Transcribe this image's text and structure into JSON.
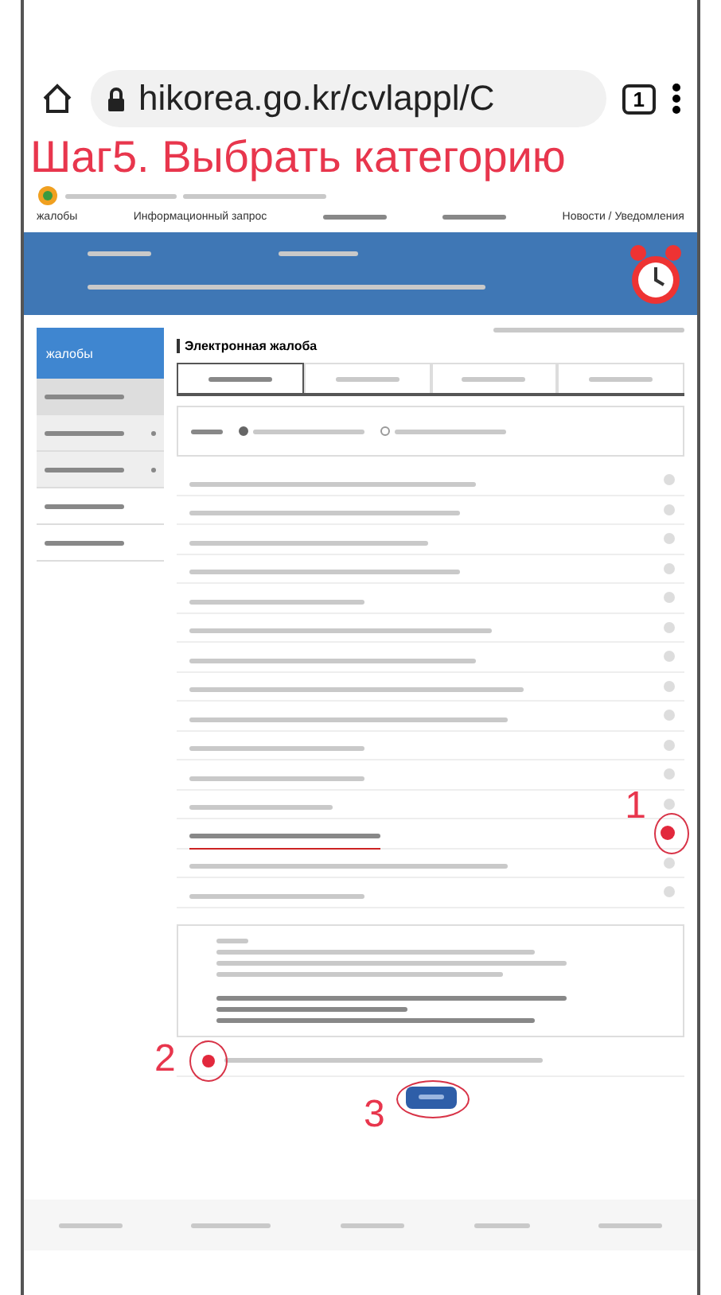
{
  "browser": {
    "url": "hikorea.go.kr/cvlappl/C",
    "tab_count": "1"
  },
  "annotation_title": "Шаг5. Выбрать категорию",
  "nav": [
    {
      "label": "жалобы"
    },
    {
      "label": "Информационный запрос"
    },
    {
      "label": "Новости / Уведомления"
    }
  ],
  "sidebar": {
    "title": "жалобы",
    "items": [
      {
        "selected": true,
        "expandable": false
      },
      {
        "selected": false,
        "expandable": true
      },
      {
        "selected": false,
        "expandable": true
      },
      {
        "selected": false,
        "expandable": false
      },
      {
        "selected": false,
        "expandable": false
      }
    ]
  },
  "page_title": "Электронная жалоба",
  "tabs": [
    {
      "selected": true
    },
    {
      "selected": false
    },
    {
      "selected": false
    },
    {
      "selected": false
    }
  ],
  "applicant_options": [
    {
      "selected": true
    },
    {
      "selected": false
    }
  ],
  "categories": [
    {
      "selected": false
    },
    {
      "selected": false
    },
    {
      "selected": false
    },
    {
      "selected": false
    },
    {
      "selected": false
    },
    {
      "selected": false
    },
    {
      "selected": false
    },
    {
      "selected": false
    },
    {
      "selected": false
    },
    {
      "selected": false
    },
    {
      "selected": false
    },
    {
      "selected": false
    },
    {
      "selected": true,
      "annotation": "1"
    },
    {
      "selected": false
    },
    {
      "selected": false
    }
  ],
  "agreement": {
    "checked": true,
    "annotation": "2"
  },
  "submit": {
    "annotation": "3"
  }
}
